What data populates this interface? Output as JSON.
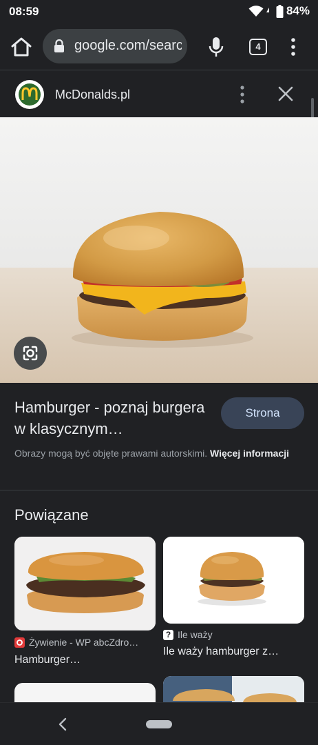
{
  "status_bar": {
    "time": "08:59",
    "battery": "84%"
  },
  "toolbar": {
    "url": "google.com/search?",
    "tab_count": "4"
  },
  "viewer": {
    "source_name": "McDonalds.pl"
  },
  "result": {
    "title": "Hamburger - poznaj burgera w klasycznym…",
    "visit_label": "Strona",
    "copyright_text": "Obrazy mogą być objęte prawami autorskimi.",
    "copyright_link": "Więcej informacji"
  },
  "related": {
    "heading": "Powiązane",
    "items": [
      {
        "source": "Żywienie - WP abcZdro…",
        "title": "Hamburger…"
      },
      {
        "source": "Ile waży",
        "title": "Ile waży hamburger z…"
      }
    ]
  },
  "colors": {
    "background": "#202124",
    "accent_button": "#394457",
    "mcdonalds_logo_green": "#2d6a2e",
    "mcdonalds_arches_yellow": "#ffc72c"
  },
  "icons": [
    "home-icon",
    "lock-icon",
    "mic-icon",
    "tabs-icon",
    "more-vert-icon",
    "close-icon",
    "lens-icon",
    "back-icon",
    "wifi-icon",
    "battery-icon",
    "signal-icon"
  ]
}
